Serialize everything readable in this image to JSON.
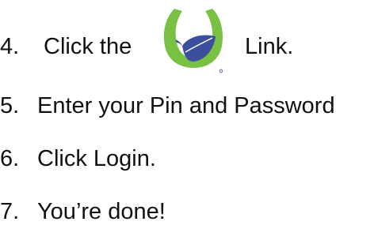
{
  "steps": [
    {
      "number": "4.",
      "text_before": "Click the",
      "text_after": "Link.",
      "icon": "q-leaf-logo-icon"
    },
    {
      "number": "5.",
      "text": "Enter your Pin and Password"
    },
    {
      "number": "6.",
      "text": "Click Login."
    },
    {
      "number": "7.",
      "text": "You’re done!"
    }
  ],
  "colors": {
    "text": "#111111",
    "logo_ring": "#79c142",
    "logo_leaf": "#3b4f9d"
  }
}
